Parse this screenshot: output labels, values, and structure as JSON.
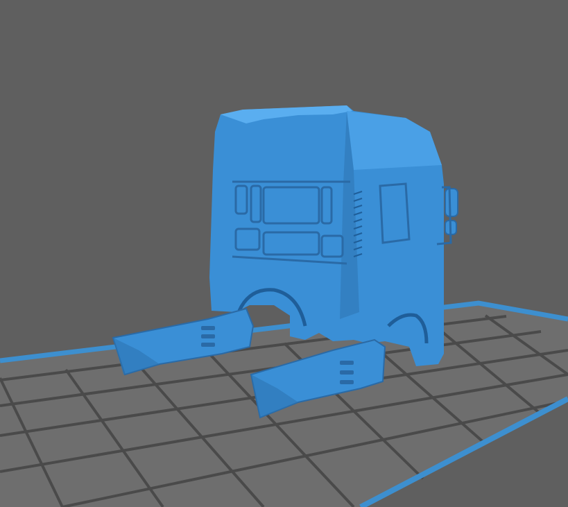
{
  "viewport": {
    "label": "3d-slicer-preview",
    "background_color": "#5f5f5f",
    "plate_fill_color": "#6e6e6e",
    "plate_grid_color": "#4a4a4a",
    "plate_border_color": "#3d8fcf",
    "model_color": "#3a8fd6",
    "model_shade_color": "#2d74b3",
    "model_highlight_color": "#5aaef0"
  },
  "model": {
    "name": "truck-cab-model"
  }
}
